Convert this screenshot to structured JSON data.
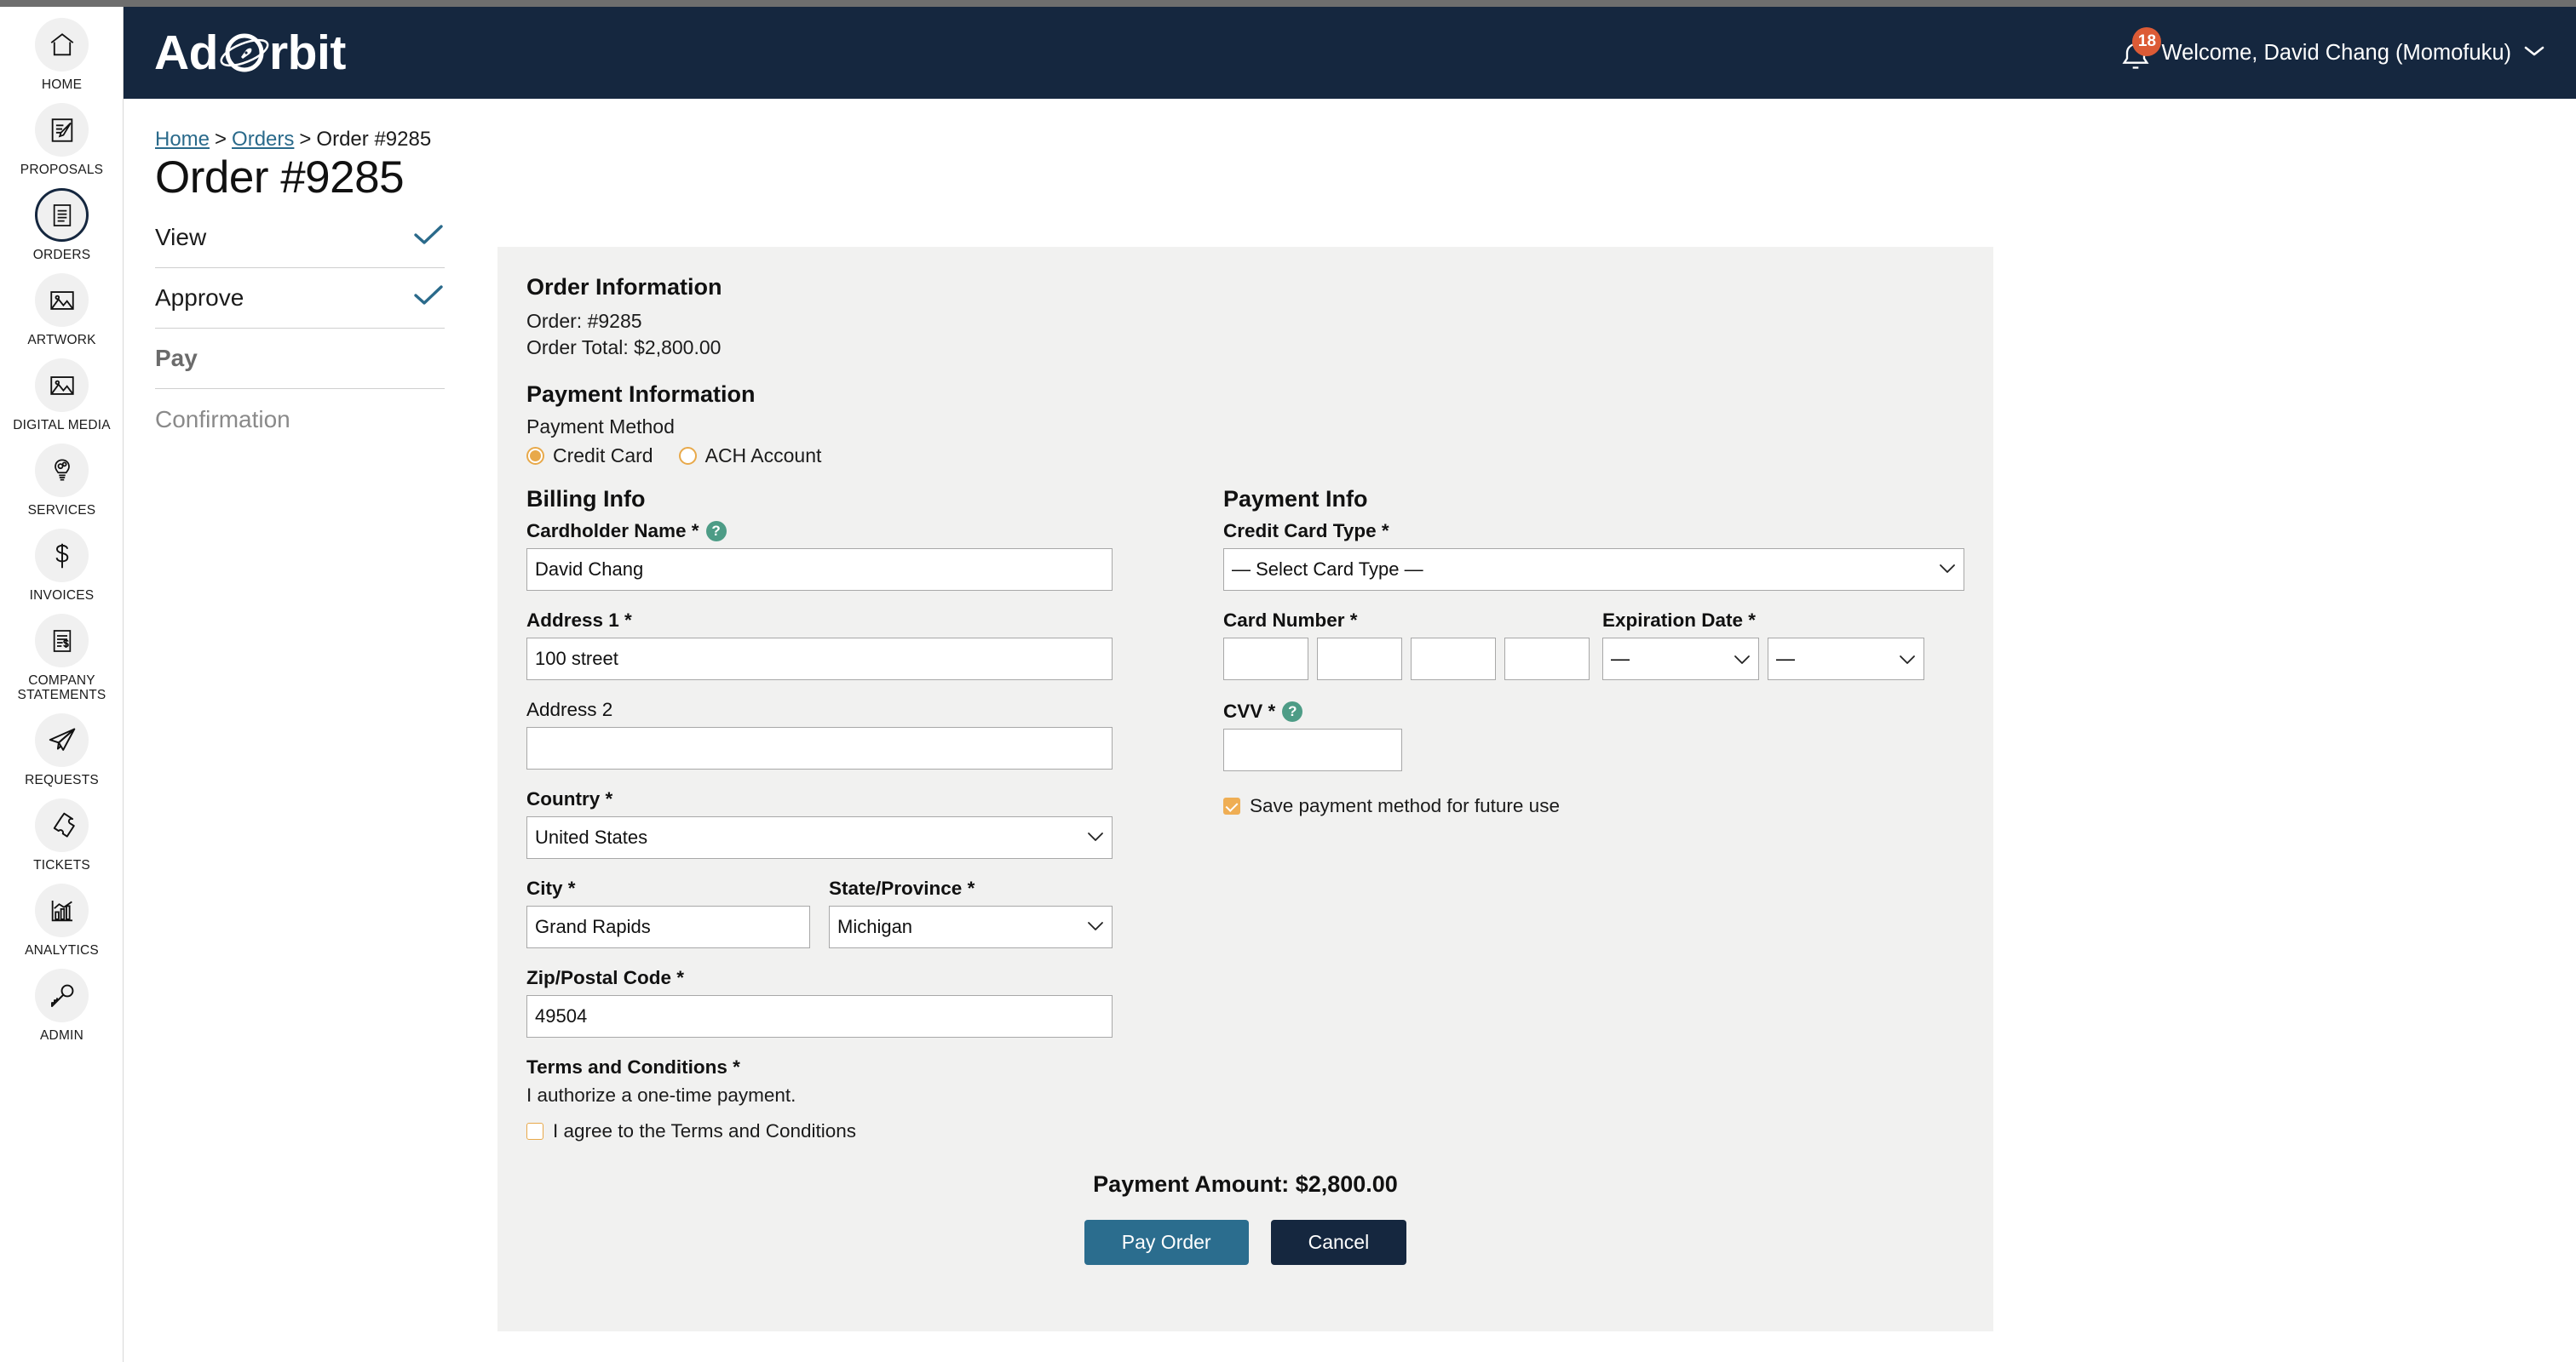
{
  "app": {
    "logo_text_left": "Ad",
    "logo_text_right": "rbit",
    "logo_icon": "planet-orbit-icon"
  },
  "header": {
    "notification_count": "18",
    "bell_icon": "bell-icon",
    "welcome_text": "Welcome, David Chang (Momofuku)",
    "chevron_icon": "chevron-down-icon"
  },
  "sidebar": {
    "items": [
      {
        "label": "HOME",
        "icon": "home-icon",
        "active": false
      },
      {
        "label": "PROPOSALS",
        "icon": "document-pencil-icon",
        "active": false
      },
      {
        "label": "ORDERS",
        "icon": "document-lines-icon",
        "active": true
      },
      {
        "label": "ARTWORK",
        "icon": "image-icon",
        "active": false
      },
      {
        "label": "DIGITAL MEDIA",
        "icon": "image-icon",
        "active": false
      },
      {
        "label": "SERVICES",
        "icon": "lightbulb-gears-icon",
        "active": false
      },
      {
        "label": "INVOICES",
        "icon": "dollar-sign-icon",
        "active": false
      },
      {
        "label": "COMPANY STATEMENTS",
        "icon": "statement-dollar-icon",
        "active": false
      },
      {
        "label": "REQUESTS",
        "icon": "paper-plane-icon",
        "active": false
      },
      {
        "label": "TICKETS",
        "icon": "ticket-icon",
        "active": false
      },
      {
        "label": "ANALYTICS",
        "icon": "bar-chart-icon",
        "active": false
      },
      {
        "label": "ADMIN",
        "icon": "key-icon",
        "active": false
      }
    ]
  },
  "breadcrumb": {
    "home": "Home",
    "orders": "Orders",
    "current": "Order #9285",
    "separator": ">"
  },
  "page": {
    "title": "Order #9285"
  },
  "steps": [
    {
      "label": "View",
      "state": "done",
      "check_icon": "check-icon"
    },
    {
      "label": "Approve",
      "state": "done",
      "check_icon": "check-icon"
    },
    {
      "label": "Pay",
      "state": "current"
    },
    {
      "label": "Confirmation",
      "state": "pending"
    }
  ],
  "order_information": {
    "heading": "Order Information",
    "order_line": "Order: #9285",
    "order_total_line": "Order Total: $2,800.00"
  },
  "payment_information": {
    "heading": "Payment Information",
    "method_label": "Payment Method",
    "methods": [
      {
        "label": "Credit Card",
        "selected": true
      },
      {
        "label": "ACH Account",
        "selected": false
      }
    ]
  },
  "billing_info": {
    "heading": "Billing Info",
    "cardholder_name": {
      "label": "Cardholder Name *",
      "value": "David Chang",
      "help_icon": "question-help-icon"
    },
    "address1": {
      "label": "Address 1 *",
      "value": "100 street"
    },
    "address2": {
      "label": "Address 2",
      "value": ""
    },
    "country": {
      "label": "Country *",
      "value": "United States"
    },
    "city": {
      "label": "City *",
      "value": "Grand Rapids"
    },
    "state": {
      "label": "State/Province *",
      "value": "Michigan"
    },
    "zip": {
      "label": "Zip/Postal Code *",
      "value": "49504"
    }
  },
  "payment_info": {
    "heading": "Payment Info",
    "card_type": {
      "label": "Credit Card Type *",
      "value": "— Select Card Type —"
    },
    "card_number": {
      "label": "Card Number *",
      "groups": [
        "",
        "",
        "",
        ""
      ]
    },
    "expiration": {
      "label": "Expiration Date *",
      "month_value": "—",
      "year_value": "—"
    },
    "cvv": {
      "label": "CVV *",
      "value": "",
      "help_icon": "question-help-icon"
    },
    "save_method": {
      "label": "Save payment method for future use",
      "checked": true
    }
  },
  "terms": {
    "heading": "Terms and Conditions *",
    "text": "I authorize a one-time payment.",
    "agree_label": "I agree to the Terms and Conditions",
    "agree_checked": false
  },
  "footer": {
    "payment_amount": "Payment Amount: $2,800.00",
    "pay_button": "Pay Order",
    "cancel_button": "Cancel"
  },
  "colors": {
    "header_bg": "#15273f",
    "accent_blue": "#2b6d8e",
    "accent_orange": "#e8a94a",
    "badge_red": "#dc5b36",
    "help_green": "#4d9c86",
    "card_bg": "#f1f1f0"
  }
}
